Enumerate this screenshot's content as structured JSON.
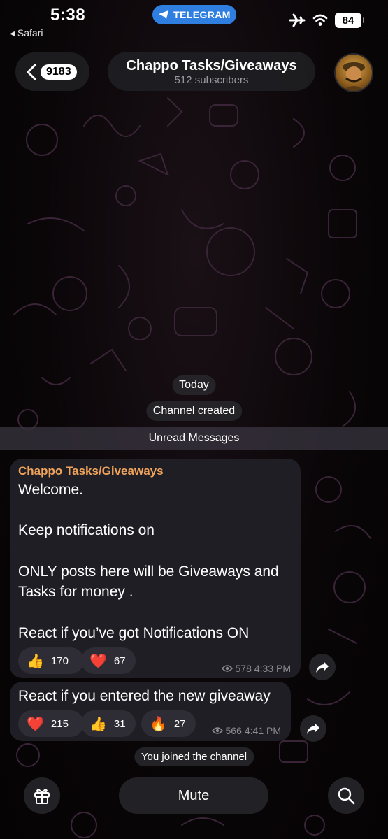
{
  "status_bar": {
    "time": "5:38",
    "back_app": "◂ Safari",
    "app_pill": "TELEGRAM",
    "battery": "84"
  },
  "header": {
    "back_count": "9183",
    "title": "Chappo Tasks/Giveaways",
    "subtitle": "512 subscribers"
  },
  "service": {
    "date": "Today",
    "created": "Channel created",
    "unread": "Unread Messages",
    "joined": "You joined the channel"
  },
  "messages": [
    {
      "sender": "Chappo Tasks/Giveaways",
      "lines": [
        "Welcome.",
        "Keep notifications on",
        "ONLY posts here will be Giveaways and",
        "Tasks for money .",
        "React if you’ve got Notifications ON"
      ],
      "reactions": [
        {
          "emoji": "👍",
          "count": "170"
        },
        {
          "emoji": "❤️",
          "count": "67"
        }
      ],
      "views": "578",
      "time": "4:33 PM"
    },
    {
      "text": "React if you entered the new giveaway",
      "reactions": [
        {
          "emoji": "❤️",
          "count": "215"
        },
        {
          "emoji": "👍",
          "count": "31"
        },
        {
          "emoji": "🔥",
          "count": "27"
        }
      ],
      "views": "566",
      "time": "4:41 PM"
    }
  ],
  "bottom": {
    "mute_label": "Mute"
  },
  "colors": {
    "accent": "#2f7fe0",
    "sender": "#f0a35a",
    "bubble": "#1f1e24"
  }
}
